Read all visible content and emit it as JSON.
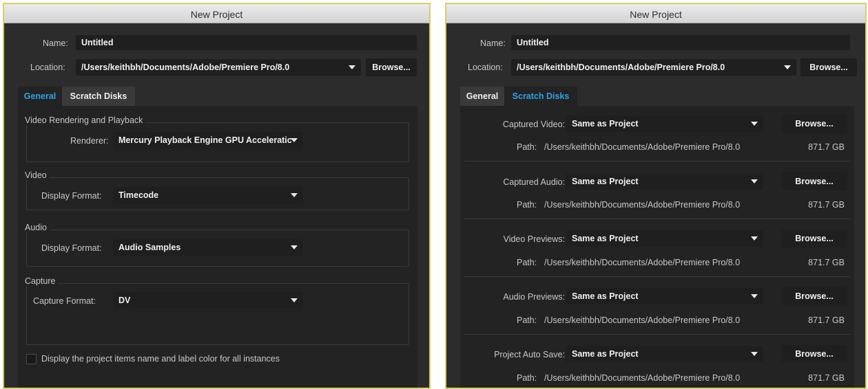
{
  "left": {
    "title": "New Project",
    "name_label": "Name:",
    "name_value": "Untitled",
    "location_label": "Location:",
    "location_value": "/Users/keithbh/Documents/Adobe/Premiere Pro/8.0",
    "browse": "Browse...",
    "tabs": [
      {
        "label": "General",
        "active": true
      },
      {
        "label": "Scratch Disks",
        "active": false
      }
    ],
    "groups": {
      "vrp": {
        "title": "Video Rendering and Playback",
        "field_label": "Renderer:",
        "value": "Mercury Playback Engine GPU Acceleratic"
      },
      "video": {
        "title": "Video",
        "field_label": "Display Format:",
        "value": "Timecode"
      },
      "audio": {
        "title": "Audio",
        "field_label": "Display Format:",
        "value": "Audio Samples"
      },
      "capture": {
        "title": "Capture",
        "field_label": "Capture Format:",
        "value": "DV"
      }
    },
    "checkbox_label": "Display the project items name and label color for all instances",
    "checkbox_checked": false
  },
  "right": {
    "title": "New Project",
    "name_label": "Name:",
    "name_value": "Untitled",
    "location_label": "Location:",
    "location_value": "/Users/keithbh/Documents/Adobe/Premiere Pro/8.0",
    "browse": "Browse...",
    "tabs": [
      {
        "label": "General",
        "active": false
      },
      {
        "label": "Scratch Disks",
        "active": true
      }
    ],
    "disks": [
      {
        "label": "Captured Video:",
        "value": "Same as Project",
        "browse": "Browse...",
        "path_label": "Path:",
        "path": "/Users/keithbh/Documents/Adobe/Premiere Pro/8.0",
        "size": "871.7 GB"
      },
      {
        "label": "Captured Audio:",
        "value": "Same as Project",
        "browse": "Browse...",
        "path_label": "Path:",
        "path": "/Users/keithbh/Documents/Adobe/Premiere Pro/8.0",
        "size": "871.7 GB"
      },
      {
        "label": "Video Previews:",
        "value": "Same as Project",
        "browse": "Browse...",
        "path_label": "Path:",
        "path": "/Users/keithbh/Documents/Adobe/Premiere Pro/8.0",
        "size": "871.7 GB"
      },
      {
        "label": "Audio Previews:",
        "value": "Same as Project",
        "browse": "Browse...",
        "path_label": "Path:",
        "path": "/Users/keithbh/Documents/Adobe/Premiere Pro/8.0",
        "size": "871.7 GB"
      },
      {
        "label": "Project Auto Save:",
        "value": "Same as Project",
        "browse": "Browse...",
        "path_label": "Path:",
        "path": "/Users/keithbh/Documents/Adobe/Premiere Pro/8.0",
        "size": "871.7 GB"
      }
    ]
  },
  "colors": {
    "accent": "#2ea3e8",
    "dialog_bg": "#2c2c2c",
    "frame": "#d6cf6c"
  },
  "icons": {
    "dropdown": "triangle-down-icon"
  }
}
